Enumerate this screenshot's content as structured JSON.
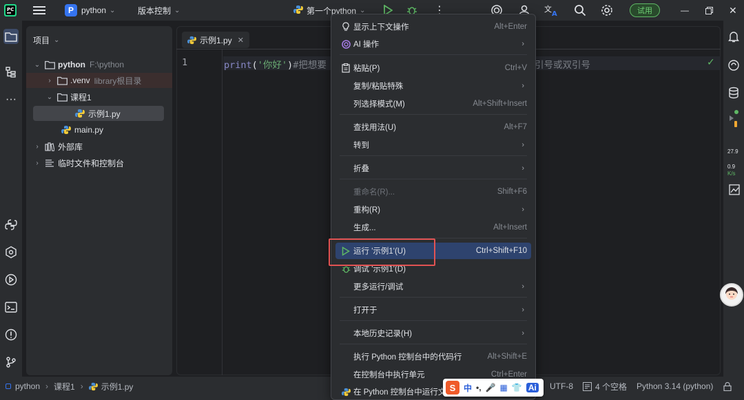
{
  "titlebar": {
    "project_name": "python",
    "project_badge": "P",
    "vcs_label": "版本控制",
    "run_config": "第一个python",
    "trial_label": "试用"
  },
  "project_panel": {
    "title": "项目",
    "tree": [
      {
        "label": "python",
        "hint": "F:\\python"
      },
      {
        "label": ".venv",
        "hint": "library根目录"
      },
      {
        "label": "课程1",
        "hint": ""
      },
      {
        "label": "示例1.py",
        "hint": ""
      },
      {
        "label": "main.py",
        "hint": ""
      },
      {
        "label": "外部库",
        "hint": ""
      },
      {
        "label": "临时文件和控制台",
        "hint": ""
      }
    ]
  },
  "editor": {
    "tab_label": "示例1.py",
    "line_number": "1",
    "code_print": "print",
    "code_paren_open": "(",
    "code_string": "'你好'",
    "code_paren_close": ")",
    "code_comment_start": "#把想要",
    "code_comment_end": "引号或双引号"
  },
  "context_menu": {
    "items": [
      {
        "label": "显示上下文操作",
        "shortcut": "Alt+Enter"
      },
      {
        "label": "AI 操作",
        "shortcut": ""
      },
      {
        "label": "粘贴(P)",
        "shortcut": "Ctrl+V"
      },
      {
        "label": "复制/粘贴特殊",
        "shortcut": ""
      },
      {
        "label": "列选择模式(M)",
        "shortcut": "Alt+Shift+Insert"
      },
      {
        "label": "查找用法(U)",
        "shortcut": "Alt+F7"
      },
      {
        "label": "转到",
        "shortcut": ""
      },
      {
        "label": "折叠",
        "shortcut": ""
      },
      {
        "label": "重命名(R)...",
        "shortcut": "Shift+F6"
      },
      {
        "label": "重构(R)",
        "shortcut": ""
      },
      {
        "label": "生成...",
        "shortcut": "Alt+Insert"
      },
      {
        "label": "运行 '示例1'(U)",
        "shortcut": "Ctrl+Shift+F10"
      },
      {
        "label": "调试 '示例1'(D)",
        "shortcut": ""
      },
      {
        "label": "更多运行/调试",
        "shortcut": ""
      },
      {
        "label": "打开于",
        "shortcut": ""
      },
      {
        "label": "本地历史记录(H)",
        "shortcut": ""
      },
      {
        "label": "执行 Python 控制台中的代码行",
        "shortcut": "Alt+Shift+E"
      },
      {
        "label": "在控制台中执行单元",
        "shortcut": "Ctrl+Enter"
      },
      {
        "label": "在 Python 控制台中运行文",
        "shortcut": ""
      }
    ]
  },
  "statusbar": {
    "crumb_project": "python",
    "crumb_folder": "课程1",
    "crumb_file": "示例1.py",
    "encoding": "UTF-8",
    "indent": "4 个空格",
    "interpreter": "Python 3.14 (python)"
  },
  "ime": {
    "mode": "中"
  },
  "right_strip": {
    "stat1": "27.9",
    "stat2": "0.9",
    "stat3": "K/s"
  }
}
